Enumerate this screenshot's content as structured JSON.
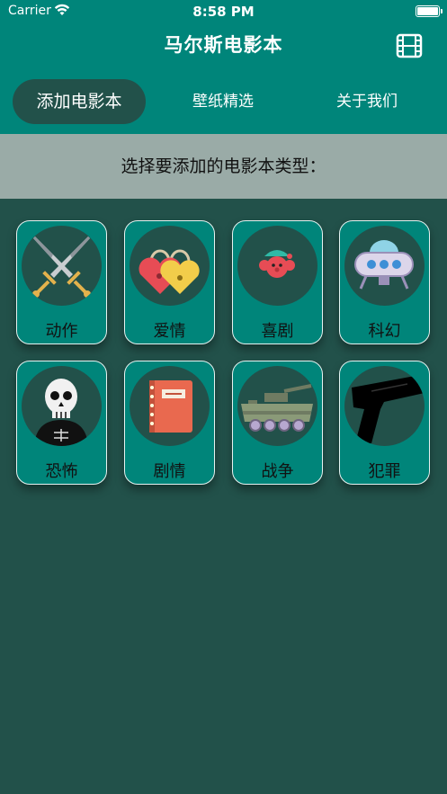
{
  "status_bar": {
    "carrier": "Carrier",
    "time": "8:58 PM"
  },
  "nav": {
    "title": "马尔斯电影本",
    "right_icon": "film-icon"
  },
  "tabs": [
    {
      "label": "添加电影本",
      "active": true
    },
    {
      "label": "壁纸精选",
      "active": false
    },
    {
      "label": "关于我们",
      "active": false
    }
  ],
  "prompt": "选择要添加的电影本类型：",
  "categories": [
    {
      "label": "动作",
      "icon": "crossed-swords-icon"
    },
    {
      "label": "爱情",
      "icon": "heart-locks-icon"
    },
    {
      "label": "喜剧",
      "icon": "clown-icon"
    },
    {
      "label": "科幻",
      "icon": "ufo-icon"
    },
    {
      "label": "恐怖",
      "icon": "skull-icon"
    },
    {
      "label": "剧情",
      "icon": "book-icon"
    },
    {
      "label": "战争",
      "icon": "tank-icon"
    },
    {
      "label": "犯罪",
      "icon": "pistol-icon"
    }
  ],
  "colors": {
    "header": "#00857a",
    "background": "#22514a",
    "prompt_bar": "#9aaba7",
    "card": "#00857a"
  }
}
